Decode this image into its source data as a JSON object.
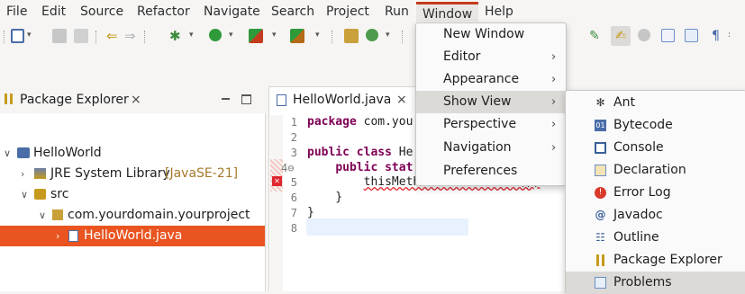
{
  "menubar": {
    "items": [
      "File",
      "Edit",
      "Source",
      "Refactor",
      "Navigate",
      "Search",
      "Project",
      "Run",
      "Window",
      "Help"
    ]
  },
  "package_explorer": {
    "title": "Package Explorer",
    "close": "×",
    "tree": {
      "project": "HelloWorld",
      "jre": "JRE System Library",
      "jre_decoration": "[JavaSE-21]",
      "src": "src",
      "package": "com.yourdomain.yourproject",
      "file": "HelloWorld.java"
    }
  },
  "editor": {
    "tab_title": "HelloWorld.java",
    "close": "×",
    "line_numbers": [
      "1",
      "2",
      "3",
      "4⊖",
      "5",
      "6",
      "7",
      "8"
    ],
    "code": {
      "l1_kw": "package",
      "l1_rest": " com.you",
      "l3_kw": "public class",
      "l3_rest": " He",
      "l4_indent": "    ",
      "l4_kw": "public stat",
      "l5_indent": "        ",
      "l5_call": "thisMethodDoesNotExist();",
      "l6": "    }",
      "l7": "}"
    }
  },
  "window_menu": {
    "items": [
      {
        "label": "New Window",
        "arrow": ""
      },
      {
        "label": "Editor",
        "arrow": "›"
      },
      {
        "label": "Appearance",
        "arrow": "›"
      },
      {
        "label": "Show View",
        "arrow": "›"
      },
      {
        "label": "Perspective",
        "arrow": "›"
      },
      {
        "label": "Navigation",
        "arrow": "›"
      },
      {
        "label": "Preferences",
        "arrow": ""
      }
    ]
  },
  "show_view_menu": {
    "items": [
      {
        "label": "Ant",
        "icon": "ant-icon"
      },
      {
        "label": "Bytecode",
        "icon": "bytecode-icon"
      },
      {
        "label": "Console",
        "icon": "console-icon"
      },
      {
        "label": "Declaration",
        "icon": "declaration-icon"
      },
      {
        "label": "Error Log",
        "icon": "error-log-icon"
      },
      {
        "label": "Javadoc",
        "icon": "javadoc-icon"
      },
      {
        "label": "Outline",
        "icon": "outline-icon"
      },
      {
        "label": "Package Explorer",
        "icon": "package-explorer-icon"
      },
      {
        "label": "Problems",
        "icon": "problems-icon"
      }
    ]
  },
  "colors": {
    "accent": "#e95420",
    "menu_underline": "#c33b1e",
    "keyword": "#7f0055"
  }
}
